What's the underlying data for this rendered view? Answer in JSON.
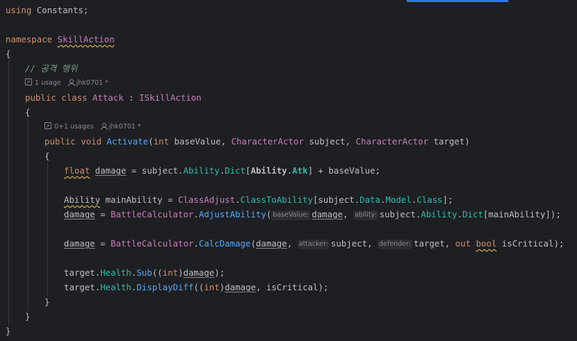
{
  "using": {
    "keyword": "using",
    "name": "Constants",
    "semi": ";"
  },
  "namespace": {
    "keyword": "namespace",
    "name": "SkillAction"
  },
  "braces": {
    "open": "{",
    "close": "}"
  },
  "comment": "// 공격 행위",
  "class_hint": {
    "usage": "1 usage",
    "author": "jhk0701 *"
  },
  "class_decl": {
    "public": "public",
    "class": "class",
    "name": "Attack",
    "colon": ":",
    "iface": "ISkillAction"
  },
  "method_hint": {
    "usage": "0+1 usages",
    "author": "jhk0701 *"
  },
  "method_decl": {
    "public": "public",
    "void": "void",
    "name": "Activate",
    "p1_type": "int",
    "p1_name": "baseValue",
    "p2_type": "CharacterActor",
    "p2_name": "subject",
    "p3_type": "CharacterActor",
    "p3_name": "target"
  },
  "line1": {
    "float": "float",
    "damage": "damage",
    "eq": " = subject.",
    "ability": "Ability",
    "dict": "Dict",
    "abilityType": "Ability",
    "atk": "Atk",
    "rest": "] + baseValue;"
  },
  "line2": {
    "type": "Ability",
    "rest1": " mainAbility = ",
    "cls": "ClassAdjust",
    "fn": "ClassToAbility",
    "rest2": "[subject.",
    "data": "Data",
    "model": "Model",
    "classProp": "Class",
    "rest3": "];"
  },
  "line3": {
    "damage": "damage",
    "rest1": " = ",
    "cls": "BattleCalculator",
    "fn": "AdjustAbility",
    "hint1": "baseValue:",
    "arg1": "damage",
    "hint2": "ability:",
    "rest2": "subject.",
    "ability": "Ability",
    "dict": "Dict",
    "rest3": "[mainAbility]);"
  },
  "line4": {
    "damage": "damage",
    "rest1": " = ",
    "cls": "BattleCalculator",
    "fn": "CalcDamage",
    "arg1": "damage",
    "hint1": "attacker:",
    "rest2": "subject, ",
    "hint2": "defender:",
    "rest3": "target, ",
    "out": "out",
    "bool": "bool",
    "rest4": " isCritical);"
  },
  "line5": {
    "rest1": "target.",
    "health": "Health",
    "fn": "Sub",
    "int": "int",
    "damage": "damage",
    "rest2": ");"
  },
  "line6": {
    "rest1": "target.",
    "health": "Health",
    "fn": "DisplayDiff",
    "int": "int",
    "damage": "damage",
    "rest2": ", isCritical);"
  }
}
